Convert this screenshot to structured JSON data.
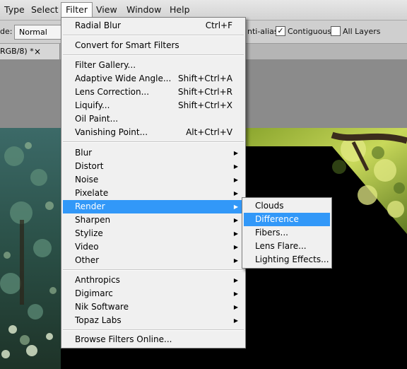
{
  "menubar": {
    "items": [
      {
        "label": "Type",
        "active": false
      },
      {
        "label": "Select",
        "active": false
      },
      {
        "label": "Filter",
        "active": true
      },
      {
        "label": "View",
        "active": false
      },
      {
        "label": "Window",
        "active": false
      },
      {
        "label": "Help",
        "active": false
      }
    ]
  },
  "options": {
    "mode_label": "de:",
    "mode_value": "Normal",
    "antialias_label": "nti-alias",
    "contiguous_label": "Contiguous",
    "contiguous_checked": "✓",
    "all_layers_label": "All Layers"
  },
  "tab": {
    "label": "RGB/8) *",
    "close": "×"
  },
  "filter_menu": {
    "radial_blur": {
      "label": "Radial Blur",
      "shortcut": "Ctrl+F"
    },
    "smart_filters": {
      "label": "Convert for Smart Filters"
    },
    "filter_gallery": {
      "label": "Filter Gallery..."
    },
    "adaptive_wide_angle": {
      "label": "Adaptive Wide Angle...",
      "shortcut": "Shift+Ctrl+A"
    },
    "lens_correction": {
      "label": "Lens Correction...",
      "shortcut": "Shift+Ctrl+R"
    },
    "liquify": {
      "label": "Liquify...",
      "shortcut": "Shift+Ctrl+X"
    },
    "oil_paint": {
      "label": "Oil Paint..."
    },
    "vanishing_point": {
      "label": "Vanishing Point...",
      "shortcut": "Alt+Ctrl+V"
    },
    "blur": {
      "label": "Blur"
    },
    "distort": {
      "label": "Distort"
    },
    "noise": {
      "label": "Noise"
    },
    "pixelate": {
      "label": "Pixelate"
    },
    "render": {
      "label": "Render"
    },
    "sharpen": {
      "label": "Sharpen"
    },
    "stylize": {
      "label": "Stylize"
    },
    "video": {
      "label": "Video"
    },
    "other": {
      "label": "Other"
    },
    "anthropics": {
      "label": "Anthropics"
    },
    "digimarc": {
      "label": "Digimarc"
    },
    "nik_software": {
      "label": "Nik Software"
    },
    "topaz_labs": {
      "label": "Topaz Labs"
    },
    "browse_online": {
      "label": "Browse Filters Online..."
    },
    "arrow_glyph": "▶"
  },
  "render_submenu": {
    "clouds": "Clouds",
    "difference_clouds": "Difference Clouds",
    "fibers": "Fibers...",
    "lens_flare": "Lens Flare...",
    "lighting_effects": "Lighting Effects..."
  },
  "colors": {
    "highlight": "#3298f8",
    "menu_bg": "#f0f0f0",
    "foliage_dark": "#2f5c58",
    "foliage_light": "#a9c23a"
  }
}
